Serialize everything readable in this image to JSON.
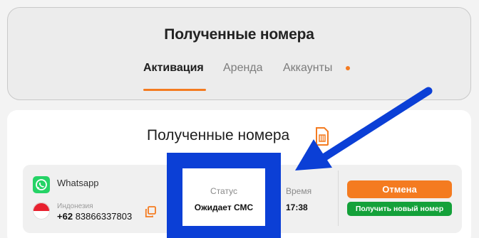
{
  "header": {
    "title": "Полученные номера",
    "tabs": [
      {
        "label": "Активация",
        "active": true
      },
      {
        "label": "Аренда",
        "active": false
      },
      {
        "label": "Аккаунты",
        "active": false
      }
    ]
  },
  "main": {
    "title": "Полученные номера",
    "order": {
      "service": "Whatsapp",
      "country": "Индонезия",
      "phone_code": "+62",
      "phone_number": "83866337803",
      "status_label": "Статус",
      "status_value": "Ожидает СМС",
      "time_label": "Время",
      "time_value": "17:38",
      "cancel_label": "Отмена",
      "new_number_label": "Получить новый номер"
    }
  },
  "colors": {
    "accent_orange": "#f47b20",
    "success_green": "#14a13a",
    "annotation_blue": "#0b3fd6",
    "whatsapp_green": "#25d366",
    "flag_red": "#e8202e"
  },
  "icons": {
    "sim": "sim-card-icon",
    "service": "whatsapp-icon",
    "flag": "indonesia-flag-icon",
    "copy": "copy-icon",
    "notification": "notification-dot-icon"
  }
}
